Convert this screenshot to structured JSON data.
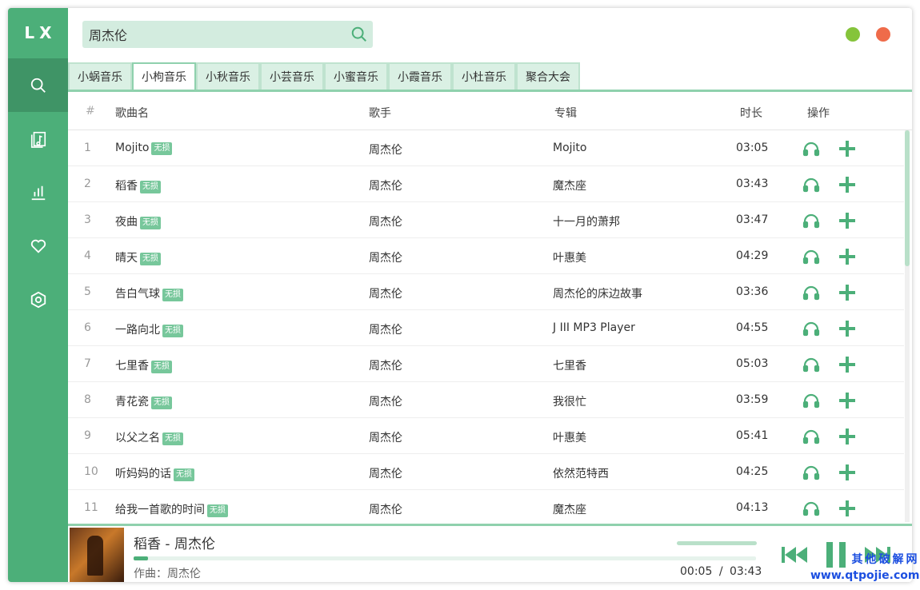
{
  "app": {
    "logo": "LX"
  },
  "colors": {
    "accent": "#4caf79",
    "accent_dark": "#3f9466",
    "badge": "#77c79b",
    "min_button": "#85c43b",
    "close_button": "#ef6b4a"
  },
  "sidebar": {
    "items": [
      {
        "icon": "search-icon",
        "active": true
      },
      {
        "icon": "song-list-icon",
        "active": false
      },
      {
        "icon": "leaderboard-icon",
        "active": false
      },
      {
        "icon": "heart-icon",
        "active": false
      },
      {
        "icon": "settings-icon",
        "active": false
      }
    ]
  },
  "search": {
    "value": "周杰伦",
    "icon": "search-icon"
  },
  "tabs": [
    {
      "label": "小蜗音乐"
    },
    {
      "label": "小枸音乐"
    },
    {
      "label": "小秋音乐"
    },
    {
      "label": "小芸音乐"
    },
    {
      "label": "小蜜音乐"
    },
    {
      "label": "小霞音乐"
    },
    {
      "label": "小杜音乐"
    },
    {
      "label": "聚合大会"
    }
  ],
  "active_tab": 1,
  "table": {
    "headers": {
      "num": "#",
      "name": "歌曲名",
      "singer": "歌手",
      "album": "专辑",
      "duration": "时长",
      "actions": "操作"
    },
    "badge_label": "无损",
    "rows": [
      {
        "num": "1",
        "name": "Mojito",
        "singer": "周杰伦",
        "album": "Mojito",
        "duration": "03:05"
      },
      {
        "num": "2",
        "name": "稻香",
        "singer": "周杰伦",
        "album": "魔杰座",
        "duration": "03:43"
      },
      {
        "num": "3",
        "name": "夜曲",
        "singer": "周杰伦",
        "album": "十一月的萧邦",
        "duration": "03:47"
      },
      {
        "num": "4",
        "name": "晴天",
        "singer": "周杰伦",
        "album": "叶惠美",
        "duration": "04:29"
      },
      {
        "num": "5",
        "name": "告白气球",
        "singer": "周杰伦",
        "album": "周杰伦的床边故事",
        "duration": "03:36"
      },
      {
        "num": "6",
        "name": "一路向北",
        "singer": "周杰伦",
        "album": "J III MP3 Player",
        "duration": "04:55"
      },
      {
        "num": "7",
        "name": "七里香",
        "singer": "周杰伦",
        "album": "七里香",
        "duration": "05:03"
      },
      {
        "num": "8",
        "name": "青花瓷",
        "singer": "周杰伦",
        "album": "我很忙",
        "duration": "03:59"
      },
      {
        "num": "9",
        "name": "以父之名",
        "singer": "周杰伦",
        "album": "叶惠美",
        "duration": "05:41"
      },
      {
        "num": "10",
        "name": "听妈妈的话",
        "singer": "周杰伦",
        "album": "依然范特西",
        "duration": "04:25"
      },
      {
        "num": "11",
        "name": "给我一首歌的时间",
        "singer": "周杰伦",
        "album": "魔杰座",
        "duration": "04:13"
      }
    ]
  },
  "player": {
    "title": "稻香 - 周杰伦",
    "author": "作曲：周杰伦",
    "current_time": "00:05",
    "separator": "/",
    "total_time": "03:43",
    "progress_fraction": 0.023,
    "volume_fraction": 1.0
  },
  "watermark": {
    "line1": "其他破解网",
    "line2": "www.qtpojie.com"
  }
}
